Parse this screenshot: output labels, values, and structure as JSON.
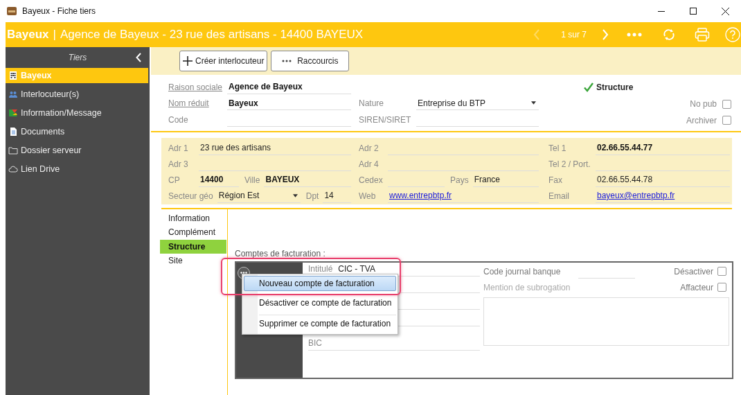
{
  "window": {
    "title": "Bayeux - Fiche tiers"
  },
  "header": {
    "name": "Bayeux",
    "separator": "|",
    "subtitle": "Agence de Bayeux - 23 rue des artisans - 14400 BAYEUX",
    "pager": "1 sur 7",
    "prev_disabled": true
  },
  "sidebar": {
    "title": "Tiers",
    "items": [
      {
        "label": "Bayeux",
        "selected": true
      },
      {
        "label": "Interlocuteur(s)",
        "selected": false
      },
      {
        "label": "Information/Message",
        "selected": false
      },
      {
        "label": "Documents",
        "selected": false
      },
      {
        "label": "Dossier serveur",
        "selected": false
      },
      {
        "label": "Lien Drive",
        "selected": false
      }
    ]
  },
  "toolbar": {
    "buttons": [
      {
        "label": "Créer interlocuteur"
      },
      {
        "label": "Raccourcis"
      }
    ]
  },
  "identity": {
    "rows": [
      {
        "fields": [
          {
            "label": "Raison sociale",
            "value": "Agence de Bayeux",
            "kind": "strong",
            "link_label": true
          }
        ]
      },
      {
        "fields": [
          {
            "label": "Nom réduit",
            "value": "Bayeux",
            "kind": "strong",
            "link_label": true
          },
          {
            "label": "Nature",
            "value": "Entreprise du BTP",
            "kind": "dropdown",
            "link_label": false
          }
        ]
      },
      {
        "fields": [
          {
            "label": "Code",
            "link_label": false
          },
          {
            "label": "SIREN/SIRET",
            "link_label": false
          }
        ]
      }
    ],
    "badge": {
      "label": "Structure",
      "checked": true
    },
    "checkboxes": [
      {
        "label": "No pub",
        "checked": false
      },
      {
        "label": "Archiver",
        "checked": false
      }
    ]
  },
  "address": {
    "rows": [
      {
        "groups": [
          {
            "fields": [
              {
                "label": "Adr 1",
                "value": "23 rue des artisans",
                "kind": "plain"
              }
            ]
          },
          {
            "fields": [
              {
                "label": "Adr 2"
              }
            ]
          },
          {
            "fields": [
              {
                "label": "Tel 1",
                "value": "02.66.55.44.77",
                "kind": "strong"
              }
            ]
          }
        ]
      },
      {
        "groups": [
          {
            "fields": [
              {
                "label": "Adr 3"
              }
            ]
          },
          {
            "fields": [
              {
                "label": "Adr 4"
              }
            ]
          },
          {
            "fields": [
              {
                "label": "Tel 2 / Port."
              }
            ]
          }
        ]
      },
      {
        "groups": [
          {
            "fields": [
              {
                "label": "CP",
                "value": "14400",
                "kind": "strong"
              },
              {
                "label": "Ville",
                "value": "BAYEUX",
                "kind": "strong"
              }
            ]
          },
          {
            "fields": [
              {
                "label": "Cedex"
              },
              {
                "label": "Pays",
                "value": "France",
                "kind": "plain"
              }
            ]
          },
          {
            "fields": [
              {
                "label": "Fax",
                "value": "02.66.55.44.78",
                "kind": "plain"
              }
            ]
          }
        ]
      },
      {
        "groups": [
          {
            "fields": [
              {
                "label": "Secteur géo",
                "value": "Région Est",
                "kind": "dropdown"
              },
              {
                "label": "Dpt",
                "value": "14",
                "kind": "plain"
              }
            ]
          },
          {
            "fields": [
              {
                "label": "Web",
                "value": "www.entrepbtp.fr",
                "kind": "link"
              }
            ]
          },
          {
            "fields": [
              {
                "label": "Email",
                "value": "bayeux@entrepbtp.fr",
                "kind": "link"
              }
            ]
          }
        ]
      }
    ]
  },
  "tabs": [
    {
      "label": "Information",
      "selected": false
    },
    {
      "label": "Complément",
      "selected": false
    },
    {
      "label": "Structure",
      "selected": true
    },
    {
      "label": "Site",
      "selected": false
    }
  ],
  "accounts": {
    "title": "Comptes de facturation :",
    "fields": [
      {
        "label": "Intitulé",
        "value": "CIC - TVA"
      },
      {
        "label": "BIC"
      }
    ],
    "code_journal": {
      "label": "Code journal banque"
    },
    "mention": {
      "label": "Mention de subrogation"
    },
    "checkboxes": [
      {
        "label": "Désactiver",
        "checked": false
      },
      {
        "label": "Affacteur",
        "checked": false
      }
    ],
    "menu": [
      {
        "label": "Nouveau compte de facturation",
        "selected": true
      },
      {
        "label": "Désactiver ce compte de facturation",
        "selected": false
      },
      {
        "label": "Supprimer ce compte de facturation",
        "selected": false
      }
    ]
  }
}
